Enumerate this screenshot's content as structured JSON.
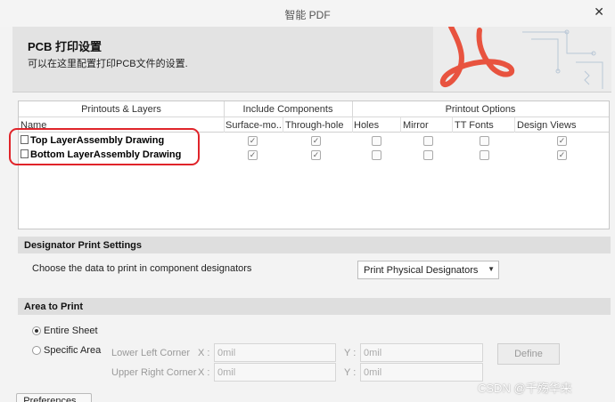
{
  "window": {
    "title": "智能 PDF",
    "close_glyph": "✕"
  },
  "header": {
    "title": "PCB 打印设置",
    "subtitle": "可以在这里配置打印PCB文件的设置."
  },
  "layers_table": {
    "group_headers": [
      "Printouts & Layers",
      "Include Components",
      "Printout Options"
    ],
    "columns": [
      "Name",
      "Surface-mo...",
      "Through-hole",
      "Holes",
      "Mirror",
      "TT Fonts",
      "Design Views"
    ],
    "rows": [
      {
        "name": "Top LayerAssembly Drawing",
        "surface": true,
        "through": true,
        "holes": false,
        "mirror": false,
        "ttfonts": false,
        "design_views": true
      },
      {
        "name": "Bottom LayerAssembly Drawing",
        "surface": true,
        "through": true,
        "holes": false,
        "mirror": false,
        "ttfonts": false,
        "design_views": true
      }
    ]
  },
  "designator": {
    "section_title": "Designator Print Settings",
    "description": "Choose the data to print in component designators",
    "selected": "Print Physical Designators"
  },
  "area": {
    "section_title": "Area to Print",
    "entire_sheet_label": "Entire Sheet",
    "specific_area_label": "Specific Area",
    "selected": "Entire Sheet",
    "lower_left_label": "Lower Left Corner",
    "upper_right_label": "Upper Right Corner",
    "x_label": "X :",
    "y_label": "Y :",
    "lower_left_x": "0mil",
    "lower_left_y": "0mil",
    "upper_right_x": "0mil",
    "upper_right_y": "0mil",
    "define_button": "Define"
  },
  "footer": {
    "preferences_button": "Preferences..."
  },
  "watermark": "CSDN @千殇华来",
  "colors": {
    "highlight": "#e0242a",
    "acrobat": "#e8533f"
  },
  "icons": [
    "close-icon",
    "document-icon",
    "acrobat-logo-icon",
    "dropdown-arrow-icon"
  ]
}
